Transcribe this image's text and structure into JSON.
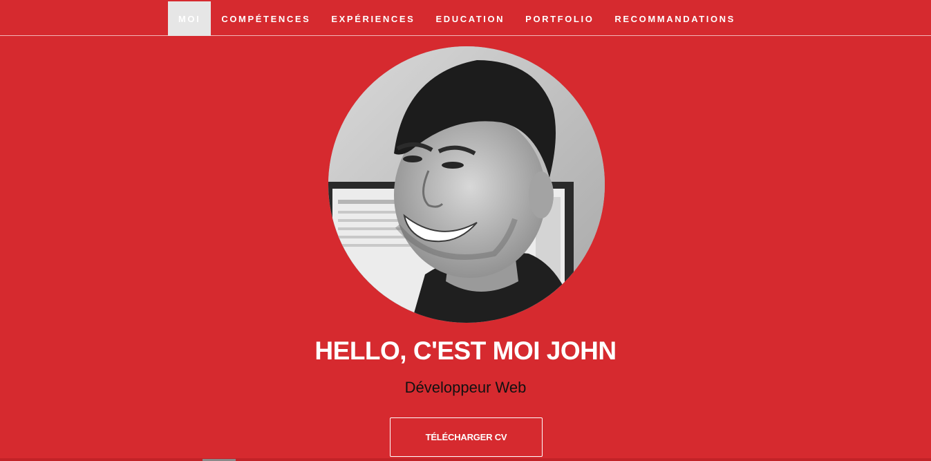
{
  "nav": {
    "items": [
      {
        "label": "MOI",
        "active": true
      },
      {
        "label": "COMPÉTENCES",
        "active": false
      },
      {
        "label": "EXPÉRIENCES",
        "active": false
      },
      {
        "label": "EDUCATION",
        "active": false
      },
      {
        "label": "PORTFOLIO",
        "active": false
      },
      {
        "label": "RECOMMANDATIONS",
        "active": false
      }
    ]
  },
  "hero": {
    "avatar_icon": "profile-photo",
    "headline": "HELLO, C'EST MOI JOHN",
    "subtitle": "Développeur Web",
    "cv_button_label": "TÉLÉCHARGER CV"
  },
  "colors": {
    "background": "#d62a2f",
    "active_tab": "#e6e6e6",
    "text_light": "#ffffff",
    "text_dark": "#111111"
  }
}
